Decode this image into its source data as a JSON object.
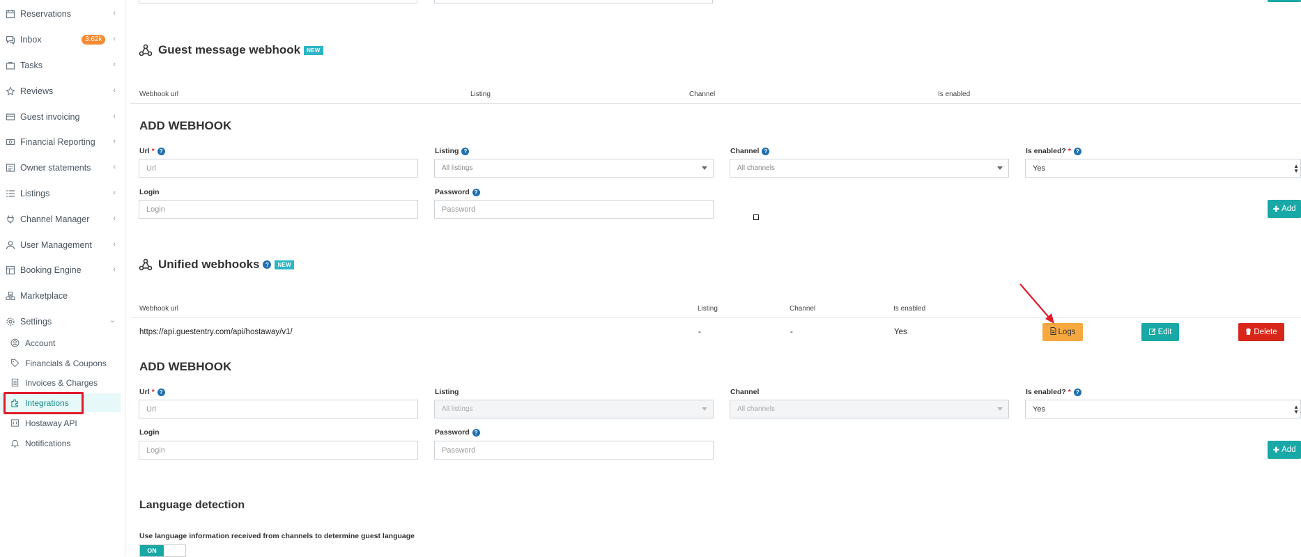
{
  "sidebar": {
    "items": [
      {
        "label": "Reservations"
      },
      {
        "label": "Inbox",
        "badge": "3.62k"
      },
      {
        "label": "Tasks"
      },
      {
        "label": "Reviews"
      },
      {
        "label": "Guest invoicing"
      },
      {
        "label": "Financial Reporting"
      },
      {
        "label": "Owner statements"
      },
      {
        "label": "Listings"
      },
      {
        "label": "Channel Manager"
      },
      {
        "label": "User Management"
      },
      {
        "label": "Booking Engine"
      },
      {
        "label": "Marketplace"
      },
      {
        "label": "Settings"
      }
    ],
    "settings_items": [
      {
        "label": "Account"
      },
      {
        "label": "Financials & Coupons"
      },
      {
        "label": "Invoices & Charges"
      },
      {
        "label": "Integrations"
      },
      {
        "label": "Hostaway API"
      },
      {
        "label": "Notifications"
      }
    ]
  },
  "guest_webhook": {
    "title": "Guest message webhook",
    "badge": "NEW",
    "columns": [
      "Webhook url",
      "Listing",
      "Channel",
      "Is enabled"
    ],
    "form": {
      "heading": "ADD WEBHOOK",
      "url_label": "Url",
      "url_placeholder": "Url",
      "listing_label": "Listing",
      "listing_value": "All listings",
      "channel_label": "Channel",
      "channel_value": "All channels",
      "enabled_label": "Is enabled?",
      "enabled_value": "Yes",
      "login_label": "Login",
      "login_placeholder": "Login",
      "password_label": "Password",
      "password_placeholder": "Password",
      "add_label": "Add"
    }
  },
  "unified_webhooks": {
    "title": "Unified webhooks",
    "badge": "NEW",
    "columns": [
      "Webhook url",
      "Listing",
      "Channel",
      "Is enabled"
    ],
    "rows": [
      {
        "url": "https://api.guestentry.com/api/hostaway/v1/",
        "listing": "-",
        "channel": "-",
        "enabled": "Yes",
        "logs_label": "Logs",
        "edit_label": "Edit",
        "delete_label": "Delete"
      }
    ],
    "form": {
      "heading": "ADD WEBHOOK",
      "url_label": "Url",
      "url_placeholder": "Url",
      "listing_label": "Listing",
      "listing_value": "All listings",
      "channel_label": "Channel",
      "channel_value": "All channels",
      "enabled_label": "Is enabled?",
      "enabled_value": "Yes",
      "login_label": "Login",
      "login_placeholder": "Login",
      "password_label": "Password",
      "password_placeholder": "Password",
      "add_label": "Add"
    }
  },
  "language_detection": {
    "title": "Language detection",
    "description": "Use language information received from channels to determine guest language",
    "toggle_label": "ON"
  },
  "colors": {
    "accent": "#18a8a6",
    "logs": "#f7a940",
    "delete": "#d8261b",
    "annotation": "#e01b2b"
  }
}
